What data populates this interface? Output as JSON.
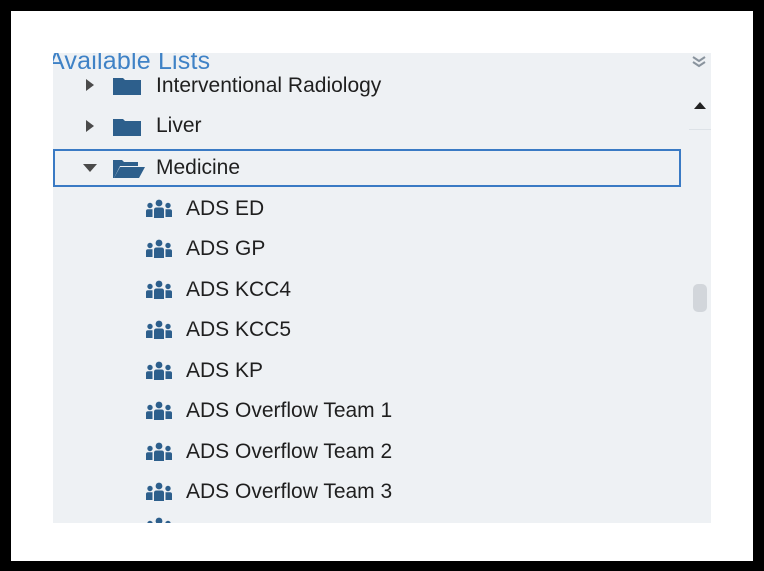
{
  "panel": {
    "title": "Available Lists"
  },
  "icons": {
    "collapse": "double-chevron-up-icon",
    "scroll_up": "triangle-up-icon",
    "expand": "triangle-right-icon",
    "collapse_arrow": "triangle-down-icon",
    "folder_closed": "folder-icon",
    "folder_open": "folder-open-icon",
    "team": "team-icon"
  },
  "colors": {
    "accent": "#3f82c6",
    "selection_border": "#3a7ac4",
    "icon": "#2d5f8c",
    "panel_background": "#eef1f4"
  },
  "tree": {
    "groups": [
      {
        "label": "Interventional Radiology",
        "expanded": false
      },
      {
        "label": "Liver",
        "expanded": false
      },
      {
        "label": "Medicine",
        "expanded": true,
        "selected": true
      }
    ],
    "items": [
      {
        "label": "ADS ED"
      },
      {
        "label": "ADS GP"
      },
      {
        "label": "ADS KCC4"
      },
      {
        "label": "ADS KCC5"
      },
      {
        "label": "ADS KP"
      },
      {
        "label": "ADS Overflow Team 1"
      },
      {
        "label": "ADS Overflow Team 2"
      },
      {
        "label": "ADS Overflow Team 3"
      }
    ]
  }
}
